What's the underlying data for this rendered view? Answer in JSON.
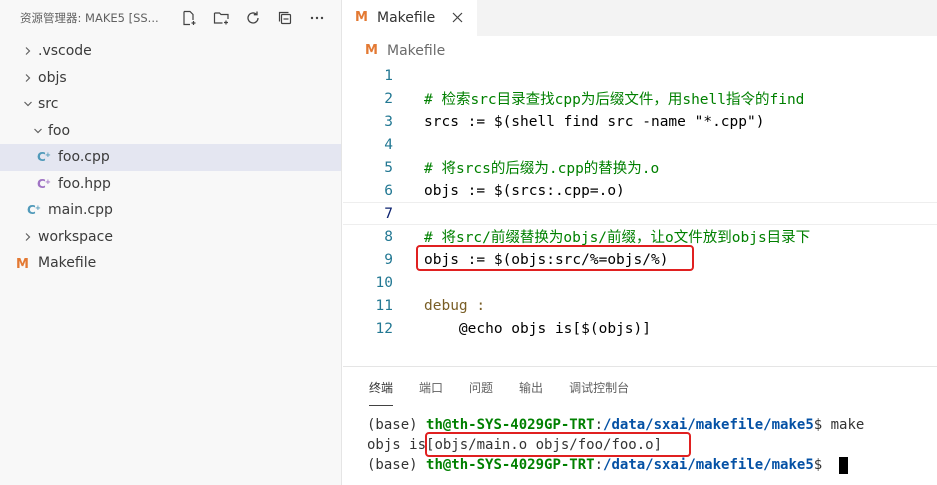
{
  "explorer": {
    "title": "资源管理器: MAKE5 [SS...",
    "actions": [
      "new-file-icon",
      "new-folder-icon",
      "refresh-icon",
      "collapse-all-icon",
      "more-icon"
    ],
    "tree": [
      {
        "label": ".vscode",
        "kind": "folder",
        "expanded": false,
        "depth": 0
      },
      {
        "label": "objs",
        "kind": "folder",
        "expanded": false,
        "depth": 0
      },
      {
        "label": "src",
        "kind": "folder",
        "expanded": true,
        "depth": 0
      },
      {
        "label": "foo",
        "kind": "folder",
        "expanded": true,
        "depth": 1
      },
      {
        "label": "foo.cpp",
        "kind": "cpp",
        "depth": 2,
        "selected": true
      },
      {
        "label": "foo.hpp",
        "kind": "hpp",
        "depth": 2
      },
      {
        "label": "main.cpp",
        "kind": "cpp",
        "depth": 1
      },
      {
        "label": "workspace",
        "kind": "folder",
        "expanded": false,
        "depth": 0
      },
      {
        "label": "Makefile",
        "kind": "makefile",
        "depth": 0
      }
    ]
  },
  "editor": {
    "tab_label": "Makefile",
    "breadcrumb": "Makefile",
    "lines": [
      {
        "n": "1",
        "text": ""
      },
      {
        "n": "2",
        "text": "# 检索src目录查找cpp为后缀文件，用shell指令的find"
      },
      {
        "n": "3",
        "text": "srcs := $(shell find src -name \"*.cpp\")"
      },
      {
        "n": "4",
        "text": ""
      },
      {
        "n": "5",
        "text": "# 将srcs的后缀为.cpp的替换为.o"
      },
      {
        "n": "6",
        "text": "objs := $(srcs:.cpp=.o)"
      },
      {
        "n": "7",
        "text": ""
      },
      {
        "n": "8",
        "text": "# 将src/前缀替换为objs/前缀，让o文件放到objs目录下"
      },
      {
        "n": "9",
        "text": "objs := $(objs:src/%=objs/%)"
      },
      {
        "n": "10",
        "text": ""
      },
      {
        "n": "11",
        "text": "debug :"
      },
      {
        "n": "12",
        "text": "    @echo objs is[$(objs)]"
      }
    ]
  },
  "panel": {
    "tabs": [
      "终端",
      "端口",
      "问题",
      "输出",
      "调试控制台"
    ],
    "active_tab": "终端",
    "terminal": {
      "env": "(base) ",
      "user_host": "th@th-SYS-4029GP-TRT",
      "sep": ":",
      "path": "/data/sxai/makefile/make5",
      "prompt_end": "$ ",
      "command": "make",
      "output_prefix": "objs is",
      "output_value": "[objs/main.o objs/foo/foo.o]"
    }
  },
  "colors": {
    "highlight_box": "#e02020",
    "makefile_icon": "#e37933",
    "cpp_icon": "#519aba",
    "hpp_icon": "#a074c4"
  }
}
